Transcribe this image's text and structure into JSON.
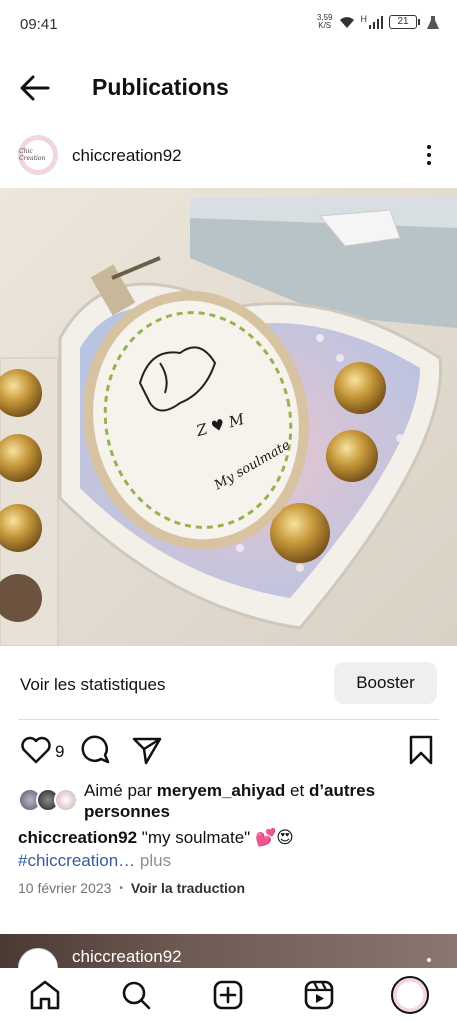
{
  "status_bar": {
    "time": "09:41",
    "net_speed": "3,59",
    "net_unit": "K/S",
    "network_type": "H",
    "battery": "21"
  },
  "header": {
    "title": "Publications",
    "back_icon": "arrow-left-icon"
  },
  "post": {
    "username": "chiccreation92",
    "avatar_text": "Chic Creation",
    "image_subject": "heart-shaped box with embroidery hoop and chocolates",
    "embroidery_text_1": "Z ♥ M",
    "embroidery_text_2": "My soulmate",
    "stats_link": "Voir les statistiques",
    "boost_label": "Booster",
    "like_count": "9",
    "liked_prefix": "Aimé par",
    "liked_user": "meryem_ahiyad",
    "liked_mid": "et",
    "liked_suffix": "d’autres personnes",
    "caption_user": "chiccreation92",
    "caption_text": " \"my soulmate\" 💕😍",
    "hashtag": "#chiccreation…",
    "more_label": " plus",
    "date": "10 février 2023",
    "separator": "•",
    "translate_label": "Voir la traduction"
  },
  "next_post": {
    "username": "chiccreation92"
  },
  "nav": {
    "items": [
      "home-icon",
      "search-icon",
      "create-icon",
      "reels-icon",
      "profile-avatar"
    ]
  },
  "colors": {
    "accent_link": "#3a5aa0",
    "secondary_text": "#737373",
    "button_bg": "#efefef"
  }
}
